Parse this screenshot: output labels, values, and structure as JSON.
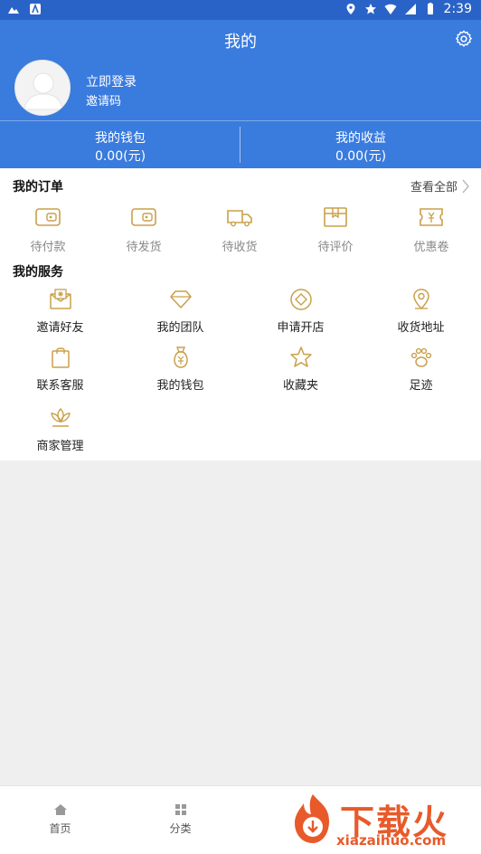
{
  "status_bar": {
    "time": "2:39"
  },
  "header": {
    "title": "我的"
  },
  "profile": {
    "login_label": "立即登录",
    "invite_label": "邀请码"
  },
  "wallet": {
    "items": [
      {
        "label": "我的钱包",
        "value": "0.00(元)"
      },
      {
        "label": "我的收益",
        "value": "0.00(元)"
      }
    ]
  },
  "orders": {
    "title": "我的订单",
    "view_all": "查看全部",
    "items": [
      {
        "label": "待付款",
        "icon": "wallet-icon"
      },
      {
        "label": "待发货",
        "icon": "wallet-icon"
      },
      {
        "label": "待收货",
        "icon": "truck-icon"
      },
      {
        "label": "待评价",
        "icon": "box-icon"
      },
      {
        "label": "优惠卷",
        "icon": "coupon-icon"
      }
    ]
  },
  "services": {
    "title": "我的服务",
    "items": [
      {
        "label": "邀请好友",
        "icon": "envelope-icon"
      },
      {
        "label": "我的团队",
        "icon": "diamond-icon"
      },
      {
        "label": "申请开店",
        "icon": "shop-icon"
      },
      {
        "label": "收货地址",
        "icon": "location-icon"
      },
      {
        "label": "联系客服",
        "icon": "bag-icon"
      },
      {
        "label": "我的钱包",
        "icon": "money-bag-icon"
      },
      {
        "label": "收藏夹",
        "icon": "star-icon"
      },
      {
        "label": "足迹",
        "icon": "paw-icon"
      },
      {
        "label": "商家管理",
        "icon": "lotus-icon"
      }
    ]
  },
  "tabbar": {
    "items": [
      {
        "label": "首页",
        "icon": "home-icon"
      },
      {
        "label": "分类",
        "icon": "grid-icon"
      }
    ]
  },
  "watermark": {
    "text_cn": "下载火",
    "text_en": "xiazaihuo.com"
  },
  "colors": {
    "header_blue": "#3a7bde",
    "status_blue": "#2a63c7",
    "icon_gold": "#c9a04a",
    "watermark_orange": "#e85a2a"
  }
}
